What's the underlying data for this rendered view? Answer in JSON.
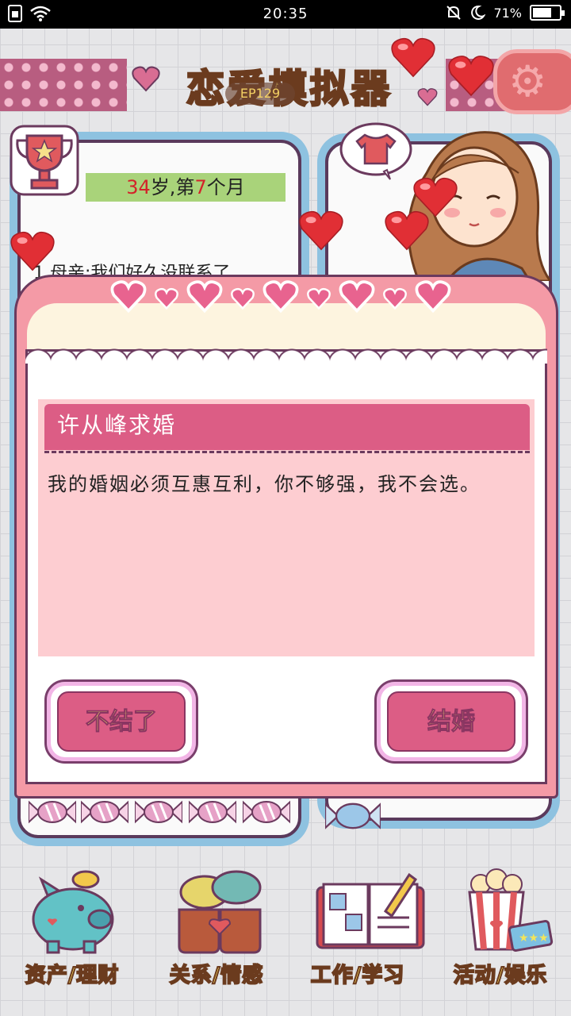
{
  "status_bar": {
    "time": "20:35",
    "battery_percent": "71%",
    "battery_level": 0.71,
    "icons": [
      "sim-card-icon",
      "wifi-icon",
      "mute-icon",
      "moon-icon",
      "battery-icon"
    ]
  },
  "header": {
    "title": "恋爱模拟器",
    "episode_label": "EP129"
  },
  "left_panel": {
    "age_prefix": "34",
    "age_mid": "岁,第",
    "month_num": "7",
    "month_suffix": "个月",
    "partial_text": "1.母亲:我们好久没联系了"
  },
  "dialog": {
    "title": "许从峰求婚",
    "message": "我的婚姻必须互惠互利，你不够强，我不会选。",
    "reject_label": "不结了",
    "accept_label": "结婚"
  },
  "bottom_nav": {
    "items": [
      {
        "label": "资产/理财",
        "icon": "piggy-bank-icon"
      },
      {
        "label": "关系/情感",
        "icon": "coffee-cups-icon"
      },
      {
        "label": "工作/学习",
        "icon": "open-book-icon"
      },
      {
        "label": "活动/娱乐",
        "icon": "popcorn-tickets-icon"
      }
    ]
  },
  "colors": {
    "accent_pink": "#dc5d85",
    "title_yellow": "#f2d45c",
    "outline_brown": "#6b3b1e",
    "panel_blue": "#8ec2e0"
  }
}
